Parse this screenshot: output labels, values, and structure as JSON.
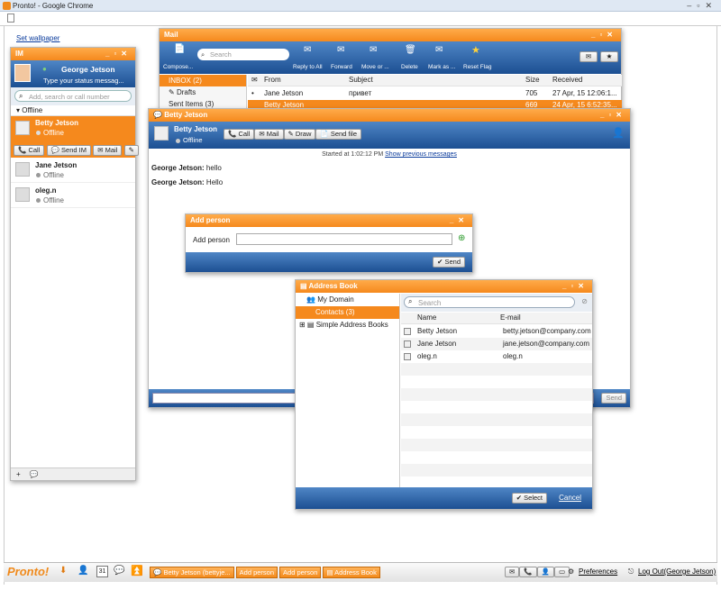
{
  "browser": {
    "title": "Pronto! - Google Chrome"
  },
  "page": {
    "set_wallpaper": "Set wallpaper"
  },
  "im": {
    "title": "IM",
    "user_name": "George Jetson",
    "status_placeholder": "Type your status messag...",
    "search_placeholder": "Add, search or call number",
    "group": "Offline",
    "contacts": [
      {
        "name": "Betty Jetson",
        "status": "Offline"
      },
      {
        "name": "Jane Jetson",
        "status": "Offline"
      },
      {
        "name": "oleg.n",
        "status": "Offline"
      }
    ],
    "actions": {
      "call": "Call",
      "send_im": "Send IM",
      "mail": "Mail"
    },
    "footer": {
      "add": "+"
    }
  },
  "mail": {
    "title": "Mail",
    "compose": "Compose...",
    "search_placeholder": "Search",
    "toolbar": {
      "reply_all": "Reply to All",
      "forward": "Forward",
      "move": "Move or ...",
      "delete": "Delete",
      "mark": "Mark as ...",
      "reset_flag": "Reset Flag"
    },
    "folders": [
      "INBOX (2)",
      "Drafts",
      "Sent Items (3)"
    ],
    "columns": {
      "from": "From",
      "subject": "Subject",
      "size": "Size",
      "received": "Received"
    },
    "rows": [
      {
        "from": "Jane Jetson",
        "subject": "привет",
        "size": "705",
        "received": "27 Apr, 15 12:06:1..."
      },
      {
        "from": "Betty Jetson",
        "subject": "",
        "size": "669",
        "received": "24 Apr, 15 6:52:35..."
      }
    ]
  },
  "chat": {
    "title": "Betty Jetson",
    "contact": "Betty Jetson",
    "status": "Offline",
    "buttons": {
      "call": "Call",
      "mail": "Mail",
      "draw": "Draw",
      "send_file": "Send file"
    },
    "started": "Started at 1:02:12 PM",
    "show_previous": "Show previous messages",
    "messages": [
      {
        "sender": "George Jetson:",
        "text": "hello"
      },
      {
        "sender": "George Jetson:",
        "text": "Hello"
      }
    ],
    "send": "Send"
  },
  "add_person": {
    "title": "Add person",
    "label": "Add person",
    "value": "",
    "send": "Send"
  },
  "address_book": {
    "title": "Address Book",
    "tree": [
      "My Domain",
      "Contacts (3)",
      "Simple Address Books"
    ],
    "search_placeholder": "Search",
    "columns": {
      "name": "Name",
      "email": "E-mail"
    },
    "rows": [
      {
        "name": "Betty Jetson",
        "email": "betty.jetson@company.com"
      },
      {
        "name": "Jane Jetson",
        "email": "jane.jetson@company.com"
      },
      {
        "name": "oleg.n",
        "email": "oleg.n"
      }
    ],
    "select": "Select",
    "cancel": "Cancel"
  },
  "taskbar": {
    "logo": "Pronto!",
    "calendar_day": "31",
    "tasks": [
      "Betty Jetson (bettyje...",
      "Add person",
      "Add person",
      "Address Book"
    ],
    "preferences": "Preferences",
    "logout": "Log Out(George Jetson)"
  },
  "colors": {
    "accent": "#f5891d",
    "blue": "#1c4f92"
  }
}
